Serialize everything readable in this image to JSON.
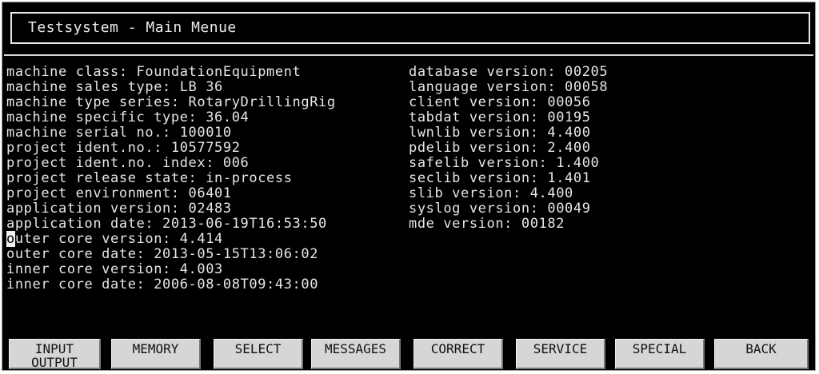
{
  "window": {
    "title": "Testsystem - Main Menue"
  },
  "left_info": [
    "machine class: FoundationEquipment",
    "machine sales type: LB 36",
    "machine type series: RotaryDrillingRig",
    "machine specific type: 36.04",
    "machine serial no.: 100010",
    "project ident.no.: 10577592",
    "project ident.no. index: 006",
    "project release state: in-process",
    "project environment: 06401",
    "application version: 02483",
    "application date: 2013-06-19T16:53:50",
    "outer core version: 4.414",
    "outer core date: 2013-05-15T13:06:02",
    "inner core version: 4.003",
    "inner core date: 2006-08-08T09:43:00"
  ],
  "right_info": [
    "database version: 00205",
    "language version: 00058",
    "client version: 00056",
    "tabdat version: 00195",
    "lwnlib version: 4.400",
    "pdelib version: 2.400",
    "safelib version: 1.400",
    "seclib version: 1.401",
    "slib version: 4.400",
    "syslog version: 00049",
    "mde version: 00182"
  ],
  "function_keys": [
    {
      "label": "INPUT\nOUTPUT"
    },
    {
      "label": "MEMORY"
    },
    {
      "label": "SELECT"
    },
    {
      "label": "MESSAGES"
    },
    {
      "label": "CORRECT"
    },
    {
      "label": "SERVICE"
    },
    {
      "label": "SPECIAL"
    },
    {
      "label": "BACK"
    }
  ],
  "colors": {
    "screen_background": "#000000",
    "text": "#e6e6e6",
    "button_face": "#d6d6d6"
  }
}
